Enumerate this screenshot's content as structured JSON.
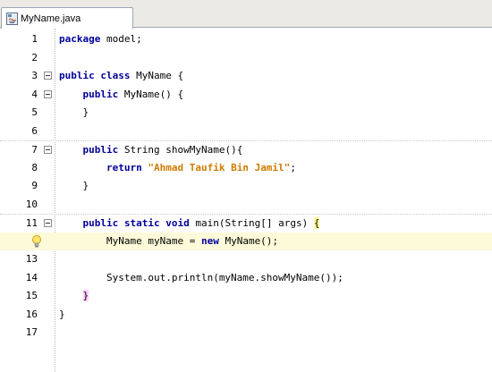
{
  "tab": {
    "title": "MyName.java"
  },
  "editor": {
    "lines": [
      {
        "num": "1",
        "indent": "",
        "segments": [
          {
            "t": "package",
            "k": "kw"
          },
          {
            "t": " model;",
            "k": ""
          }
        ]
      },
      {
        "num": "2",
        "indent": "",
        "segments": []
      },
      {
        "num": "3",
        "indent": "",
        "segments": [
          {
            "t": "public",
            "k": "kw"
          },
          {
            "t": " ",
            "k": ""
          },
          {
            "t": "class",
            "k": "kw"
          },
          {
            "t": " MyName {",
            "k": ""
          }
        ]
      },
      {
        "num": "4",
        "indent": "    ",
        "segments": [
          {
            "t": "public",
            "k": "kw"
          },
          {
            "t": " MyName() {",
            "k": ""
          }
        ]
      },
      {
        "num": "5",
        "indent": "    ",
        "segments": [
          {
            "t": "}",
            "k": ""
          }
        ]
      },
      {
        "num": "6",
        "indent": "",
        "segments": []
      },
      {
        "num": "7",
        "indent": "    ",
        "segments": [
          {
            "t": "public",
            "k": "kw"
          },
          {
            "t": " String showMyName(){",
            "k": ""
          }
        ]
      },
      {
        "num": "8",
        "indent": "        ",
        "segments": [
          {
            "t": "return",
            "k": "kw"
          },
          {
            "t": " ",
            "k": ""
          },
          {
            "t": "\"Ahmad Taufik Bin Jamil\"",
            "k": "str"
          },
          {
            "t": ";",
            "k": ""
          }
        ]
      },
      {
        "num": "9",
        "indent": "    ",
        "segments": [
          {
            "t": "}",
            "k": ""
          }
        ]
      },
      {
        "num": "10",
        "indent": "",
        "segments": []
      },
      {
        "num": "11",
        "indent": "    ",
        "segments": [
          {
            "t": "public",
            "k": "kw"
          },
          {
            "t": " ",
            "k": ""
          },
          {
            "t": "static",
            "k": "kw"
          },
          {
            "t": " ",
            "k": ""
          },
          {
            "t": "void",
            "k": "kw"
          },
          {
            "t": " main(String[] args) ",
            "k": ""
          },
          {
            "t": "{",
            "k": "hl"
          }
        ]
      },
      {
        "num": "",
        "indent": "        ",
        "segments": [
          {
            "t": "MyName myName = ",
            "k": ""
          },
          {
            "t": "new",
            "k": "kw"
          },
          {
            "t": " MyName();",
            "k": ""
          }
        ]
      },
      {
        "num": "13",
        "indent": "",
        "segments": []
      },
      {
        "num": "14",
        "indent": "        ",
        "segments": [
          {
            "t": "System.out.println(myName.showMyName());",
            "k": ""
          }
        ]
      },
      {
        "num": "15",
        "indent": "    ",
        "segments": [
          {
            "t": "}",
            "k": "hl"
          }
        ]
      },
      {
        "num": "16",
        "indent": "",
        "segments": [
          {
            "t": "}",
            "k": ""
          }
        ]
      },
      {
        "num": "17",
        "indent": "",
        "segments": []
      }
    ]
  },
  "colors": {
    "keyword": "#000099",
    "string": "#ce7b00",
    "current_line": "#fcfad9",
    "brace_match": "#ffcbff"
  }
}
